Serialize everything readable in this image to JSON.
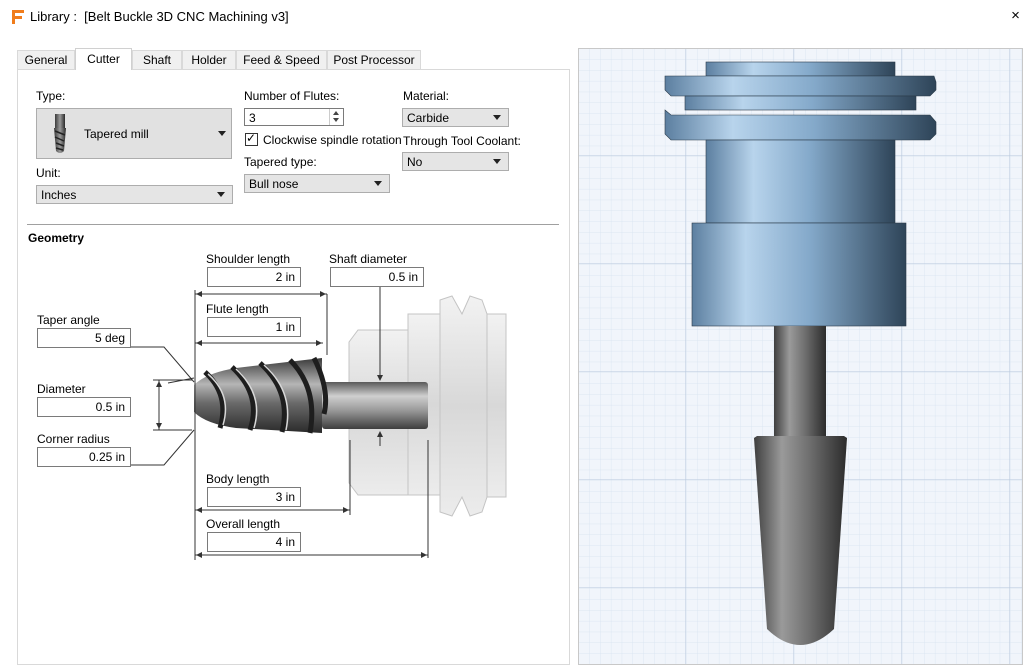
{
  "window": {
    "title": "Library :  [Belt Buckle 3D CNC Machining v3]",
    "close_glyph": "×"
  },
  "tabs": [
    {
      "label": "General"
    },
    {
      "label": "Cutter"
    },
    {
      "label": "Shaft"
    },
    {
      "label": "Holder"
    },
    {
      "label": "Feed & Speed"
    },
    {
      "label": "Post Processor"
    }
  ],
  "active_tab": "Cutter",
  "cutter": {
    "type_label": "Type:",
    "type_value": "Tapered mill",
    "unit_label": "Unit:",
    "unit_value": "Inches",
    "flutes_label": "Number of Flutes:",
    "flutes_value": "3",
    "clockwise_label": "Clockwise spindle rotation",
    "clockwise_checked": true,
    "tapered_type_label": "Tapered type:",
    "tapered_type_value": "Bull nose",
    "material_label": "Material:",
    "material_value": "Carbide",
    "coolant_label": "Through Tool Coolant:",
    "coolant_value": "No"
  },
  "geometry": {
    "title": "Geometry",
    "shoulder_length_label": "Shoulder length",
    "shoulder_length_value": "2 in",
    "shaft_diameter_label": "Shaft diameter",
    "shaft_diameter_value": "0.5 in",
    "flute_length_label": "Flute length",
    "flute_length_value": "1 in",
    "taper_angle_label": "Taper angle",
    "taper_angle_value": "5 deg",
    "diameter_label": "Diameter",
    "diameter_value": "0.5 in",
    "corner_radius_label": "Corner radius",
    "corner_radius_value": "0.25 in",
    "body_length_label": "Body length",
    "body_length_value": "3 in",
    "overall_length_label": "Overall length",
    "overall_length_value": "4 in"
  },
  "icons": {
    "app": "fusion-app-icon",
    "close": "close-icon",
    "dropdown": "chevron-down-icon"
  },
  "colors": {
    "app_icon": "#f07c1b",
    "grid_bg": "#f1f5fb",
    "grid_minor": "#d6e2f0",
    "grid_major": "#b8c8dc",
    "holder_blue": "#7fa6c8"
  }
}
